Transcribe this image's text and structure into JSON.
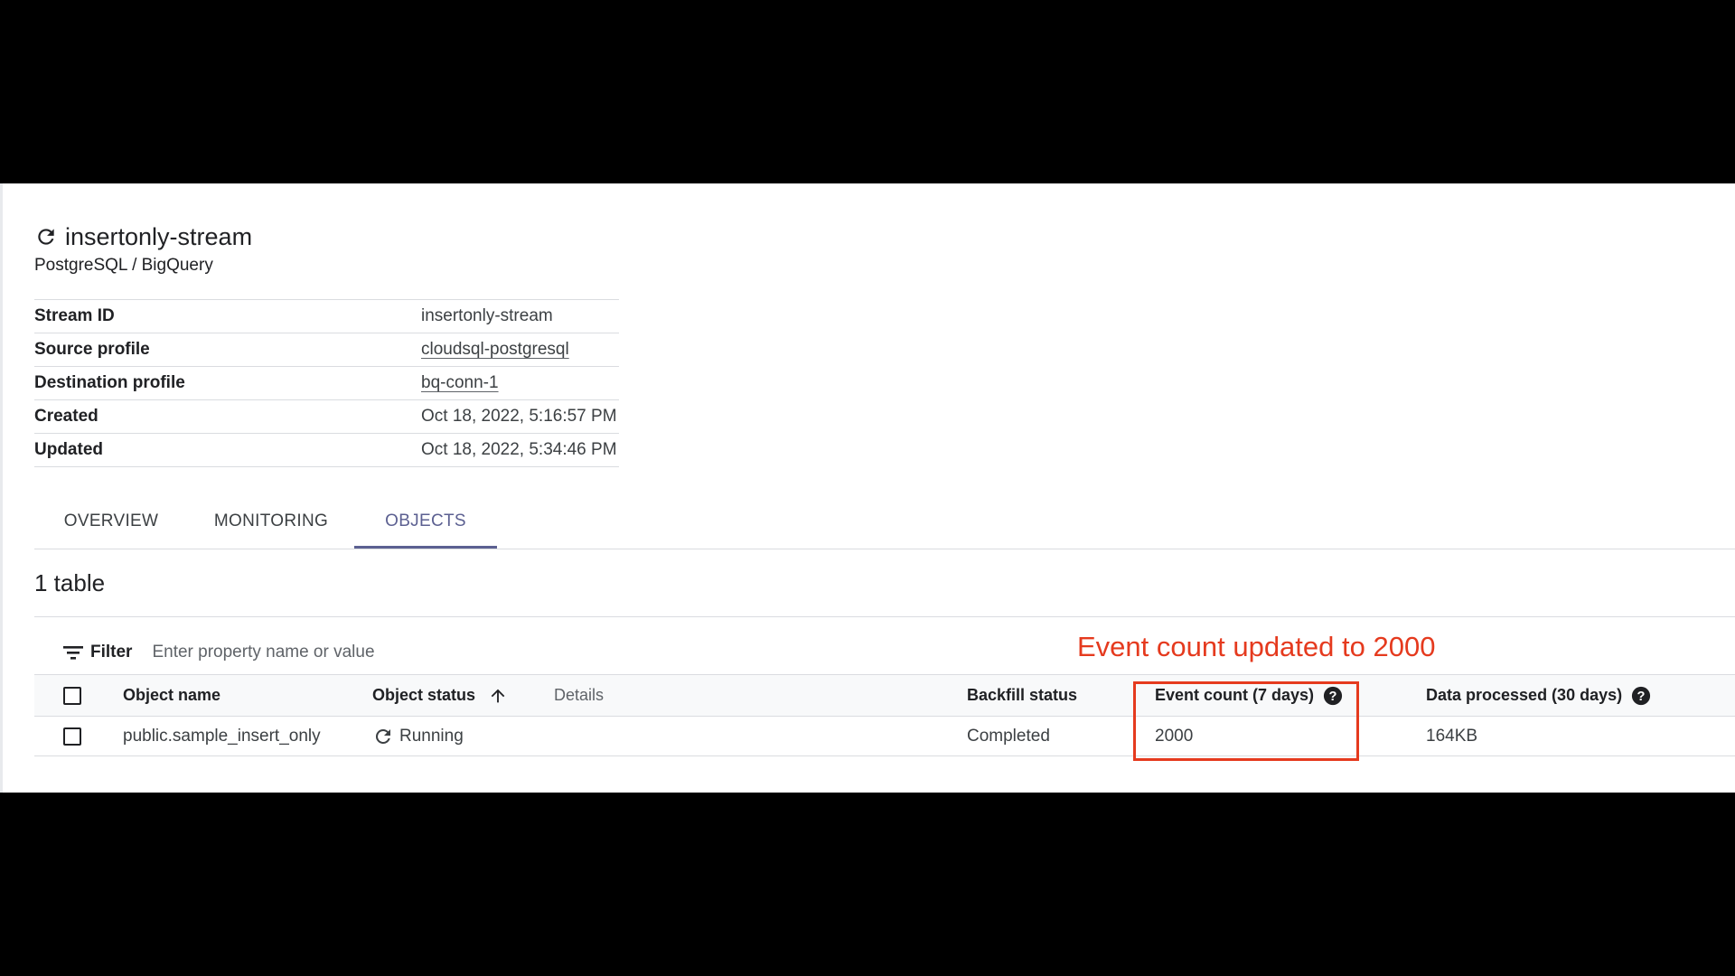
{
  "stream": {
    "name": "insertonly-stream",
    "subtitle": "PostgreSQL / BigQuery",
    "status_icon": "refresh-icon"
  },
  "properties": [
    {
      "key": "Stream ID",
      "value": "insertonly-stream",
      "link": false
    },
    {
      "key": "Source profile",
      "value": "cloudsql-postgresql",
      "link": true
    },
    {
      "key": "Destination profile",
      "value": "bq-conn-1",
      "link": true
    },
    {
      "key": "Created",
      "value": "Oct 18, 2022, 5:16:57 PM",
      "link": false
    },
    {
      "key": "Updated",
      "value": "Oct 18, 2022, 5:34:46 PM",
      "link": false
    }
  ],
  "tabs": [
    {
      "label": "OVERVIEW",
      "active": false
    },
    {
      "label": "MONITORING",
      "active": false
    },
    {
      "label": "OBJECTS",
      "active": true
    }
  ],
  "section": {
    "title": "1 table"
  },
  "filter": {
    "label": "Filter",
    "placeholder": "Enter property name or value",
    "icon": "filter-list-icon"
  },
  "annotation": "Event count updated to 2000",
  "table": {
    "headers": {
      "object_name": "Object name",
      "object_status": "Object status",
      "details": "Details",
      "backfill_status": "Backfill status",
      "event_count": "Event count (7 days)",
      "data_processed": "Data processed (30 days)"
    },
    "rows": [
      {
        "object_name": "public.sample_insert_only",
        "object_status": "Running",
        "details": "",
        "backfill_status": "Completed",
        "event_count": "2000",
        "data_processed": "164KB"
      }
    ]
  },
  "colors": {
    "accent": "#5c6091",
    "annotation": "#e53a1e",
    "background_frame": "#000000"
  }
}
